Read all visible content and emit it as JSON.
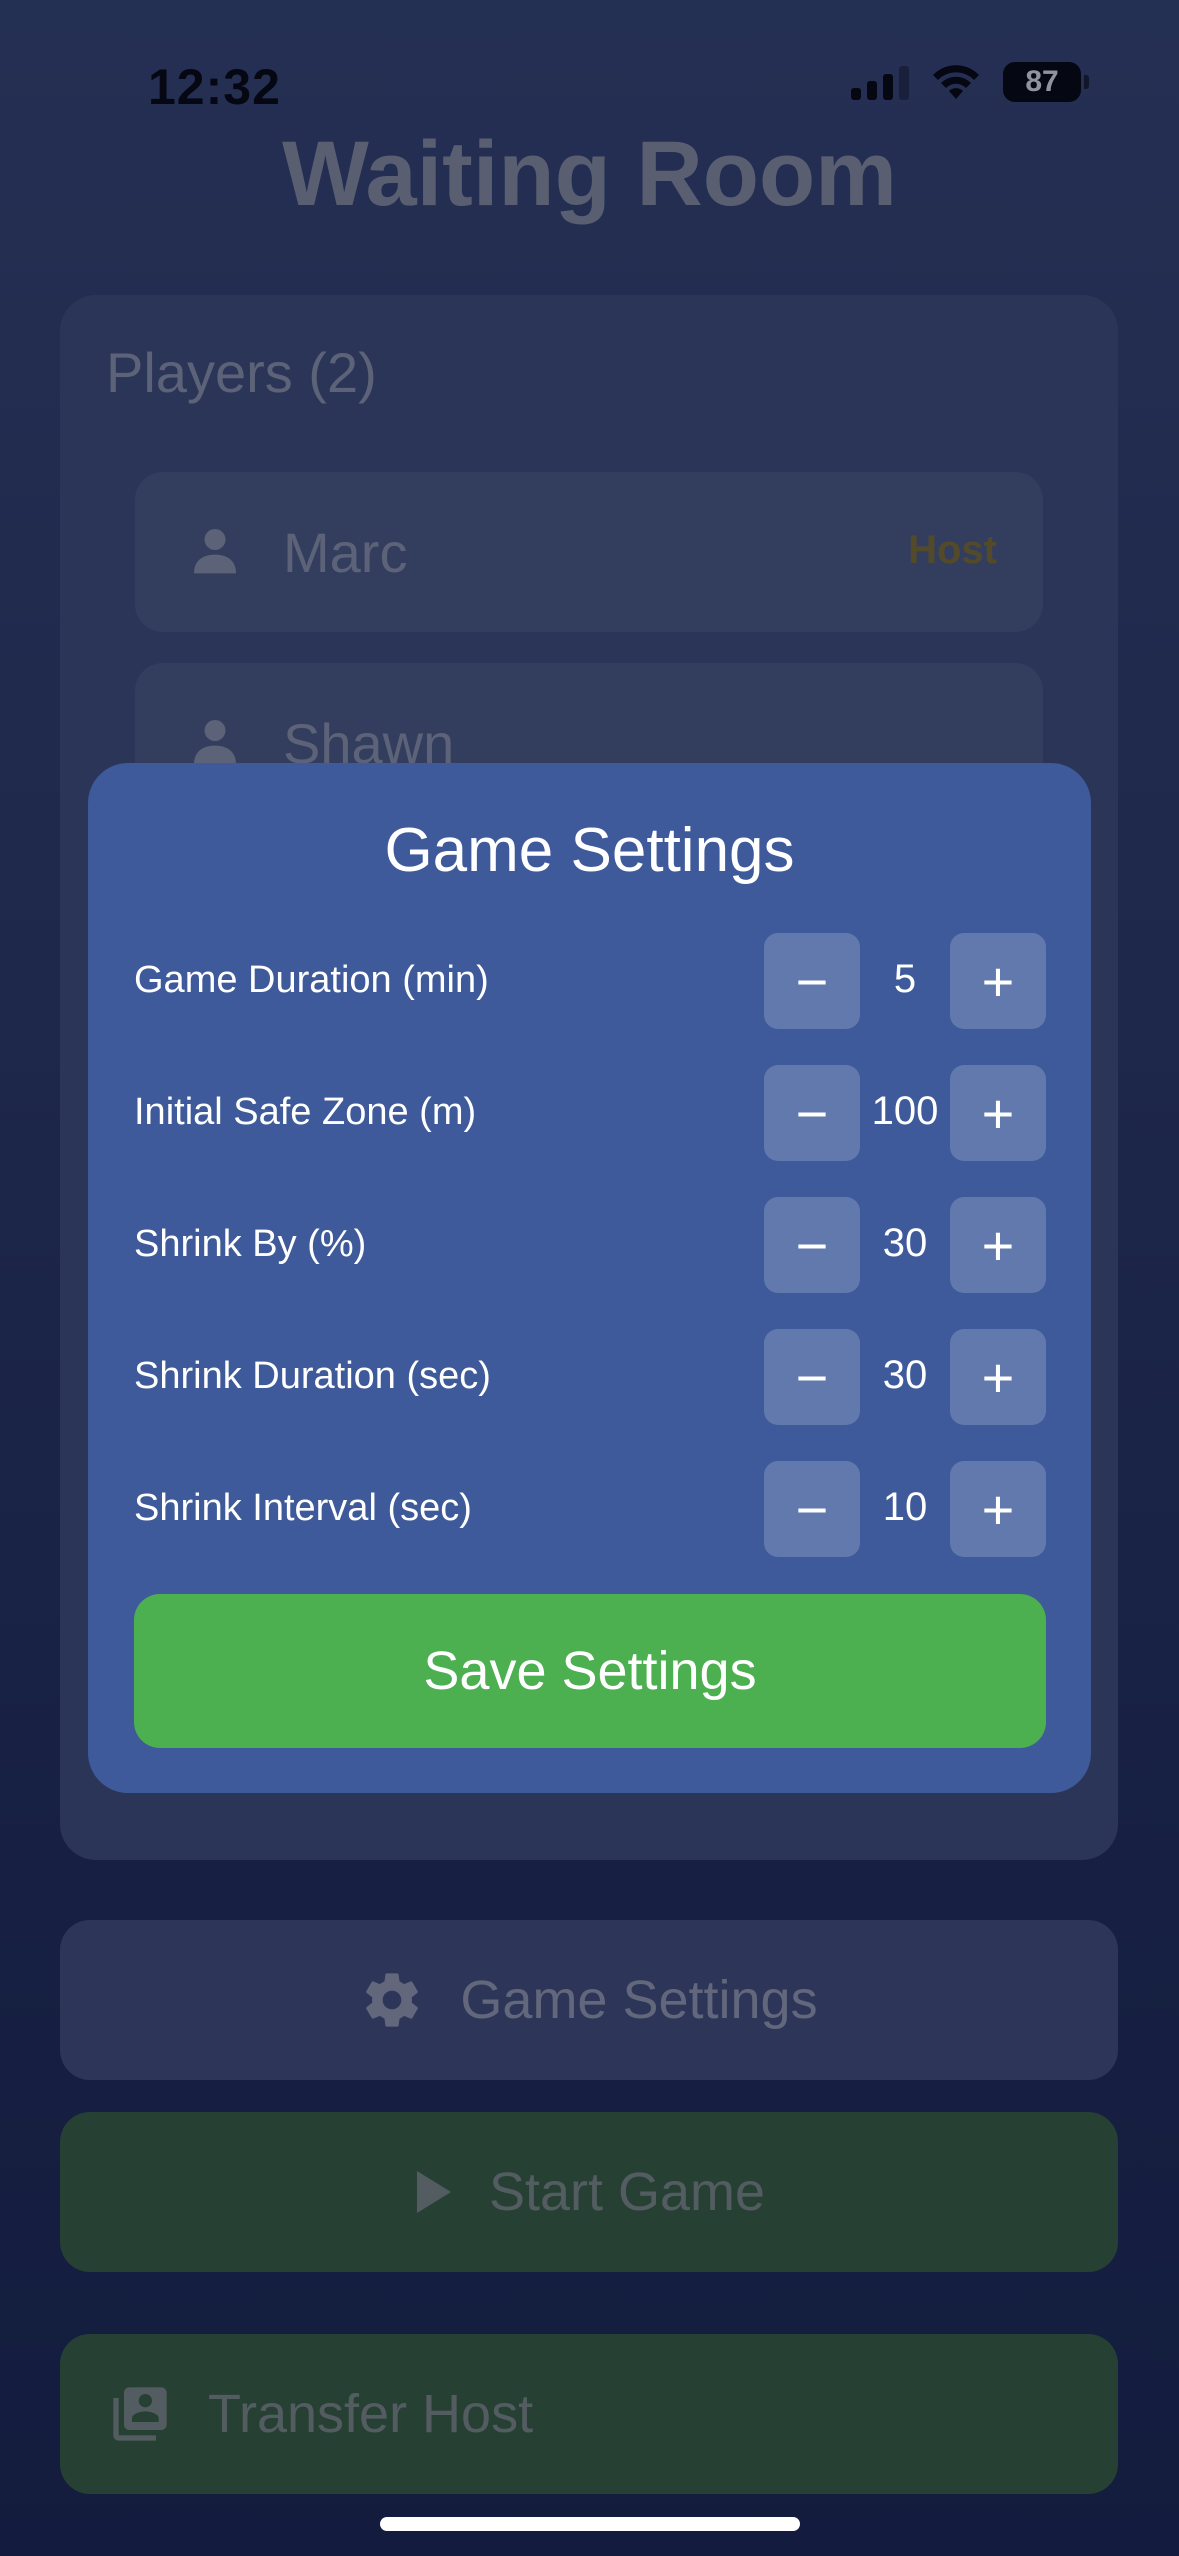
{
  "status_bar": {
    "time": "12:32",
    "battery": "87"
  },
  "page": {
    "title": "Waiting Room"
  },
  "players": {
    "heading": "Players (2)",
    "list": [
      {
        "name": "Marc",
        "badge": "Host"
      },
      {
        "name": "Shawn",
        "badge": ""
      }
    ]
  },
  "buttons": {
    "game_settings": "Game Settings",
    "start_game": "Start Game",
    "transfer_host": "Transfer Host"
  },
  "modal": {
    "title": "Game Settings",
    "settings": [
      {
        "label": "Game Duration (min)",
        "value": "5",
        "minus": "−",
        "plus": "+"
      },
      {
        "label": "Initial Safe Zone (m)",
        "value": "100",
        "minus": "−",
        "plus": "+"
      },
      {
        "label": "Shrink By (%)",
        "value": "30",
        "minus": "−",
        "plus": "+"
      },
      {
        "label": "Shrink Duration (sec)",
        "value": "30",
        "minus": "−",
        "plus": "+"
      },
      {
        "label": "Shrink Interval (sec)",
        "value": "10",
        "minus": "−",
        "plus": "+"
      }
    ],
    "save_label": "Save Settings"
  },
  "colors": {
    "modal_bg": "#3e5a9a",
    "save_green": "#4caf50",
    "host_gold": "#8e7a2a"
  }
}
